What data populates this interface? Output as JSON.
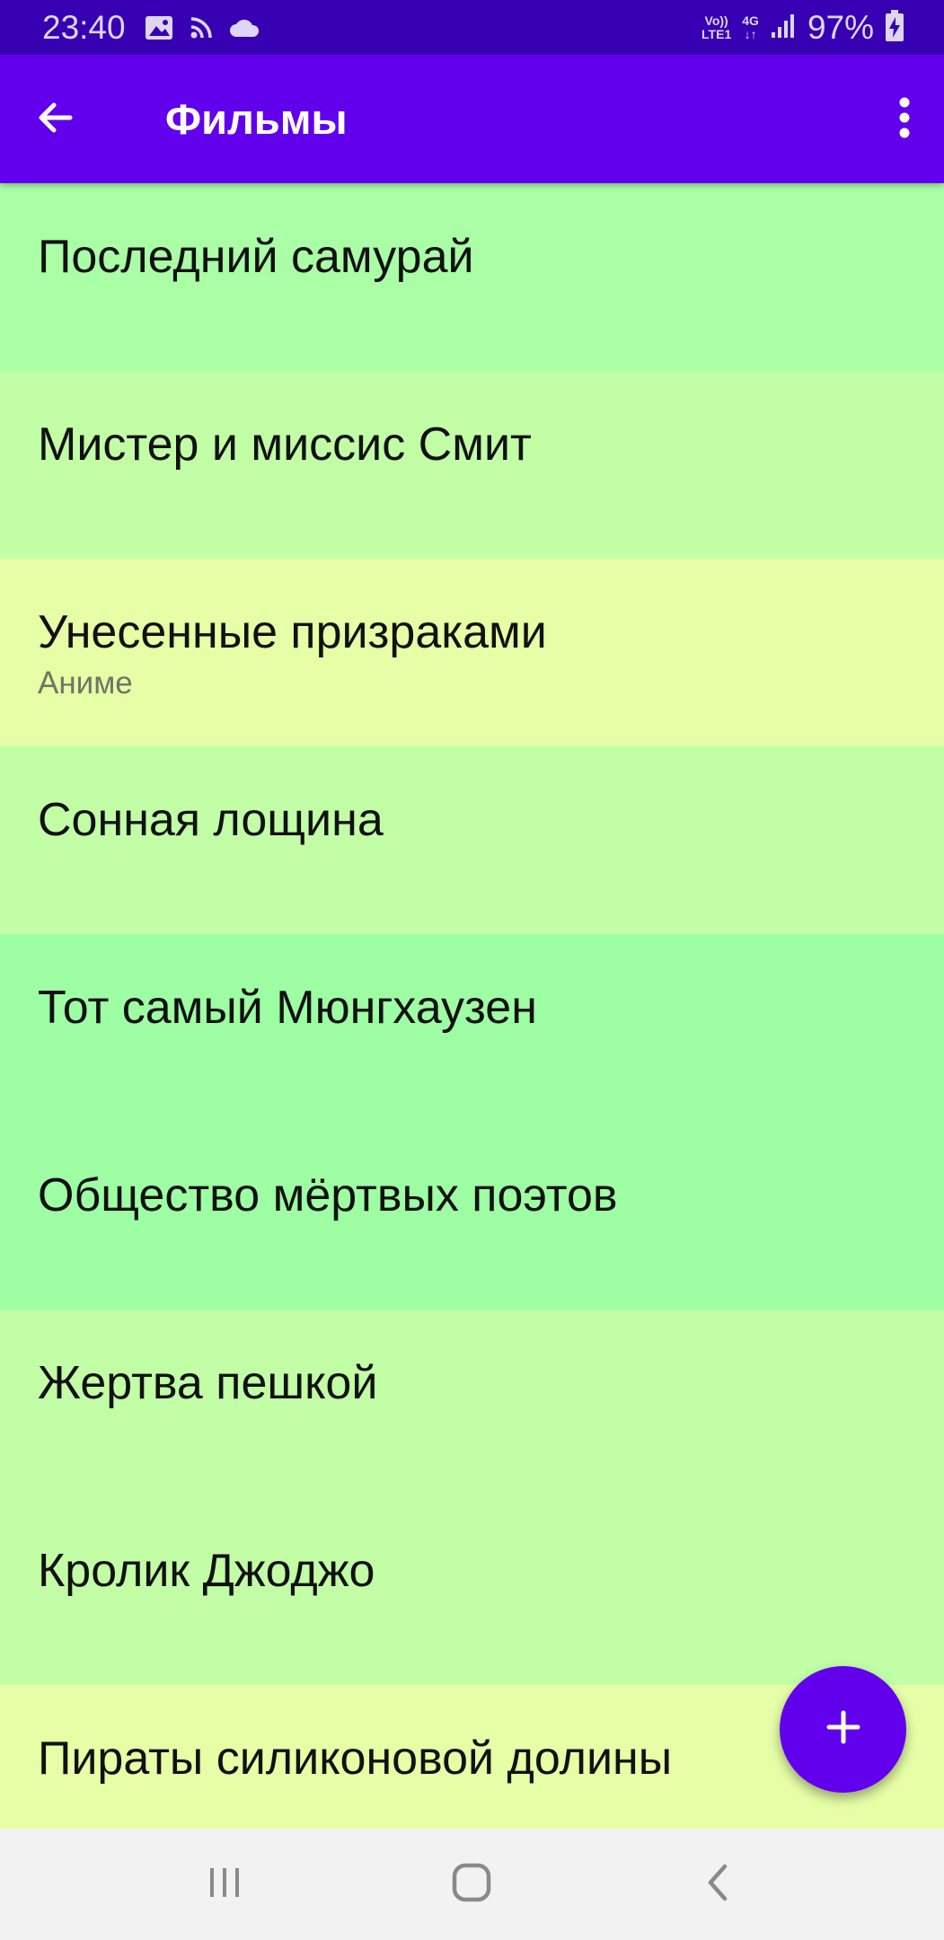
{
  "status_bar": {
    "time": "23:40",
    "left_icons": [
      "gallery-icon",
      "cast-icon",
      "cloud-icon"
    ],
    "volte_top": "Vo))",
    "volte_bottom": "LTE1",
    "network_top": "4G",
    "network_bottom": "↓↑",
    "battery_percent": "97%",
    "right_icons": [
      "signal-icon",
      "battery-charging-icon"
    ]
  },
  "app_bar": {
    "title": "Фильмы",
    "back_icon": "arrow-back-icon",
    "overflow_icon": "more-vert-icon"
  },
  "movies": [
    {
      "title": "Последний самурай",
      "genre": "",
      "color": "#aafea6"
    },
    {
      "title": "Мистер и миссис Смит",
      "genre": "",
      "color": "#c2fea6"
    },
    {
      "title": "Унесенные призраками",
      "genre": "Аниме",
      "color": "#e6fea6"
    },
    {
      "title": "Сонная лощина",
      "genre": "",
      "color": "#c2fea6"
    },
    {
      "title": "Тот самый Мюнгхаузен",
      "genre": "",
      "color": "#9efea3"
    },
    {
      "title": "Общество мёртвых поэтов",
      "genre": "",
      "color": "#9efea3"
    },
    {
      "title": "Жертва пешкой",
      "genre": "",
      "color": "#c2fea6"
    },
    {
      "title": "Кролик Джоджо",
      "genre": "",
      "color": "#c2fea6"
    },
    {
      "title": "Пираты силиконовой долины",
      "genre": "",
      "color": "#e6fea6"
    }
  ],
  "fab": {
    "icon": "add-icon",
    "color": "#6200ee"
  },
  "nav_bar": {
    "buttons": [
      "recent-apps-icon",
      "home-icon",
      "back-icon"
    ]
  },
  "colors": {
    "status_bar": "#3700b3",
    "app_bar": "#6200ee",
    "nav_bar": "#f2f2f2"
  }
}
